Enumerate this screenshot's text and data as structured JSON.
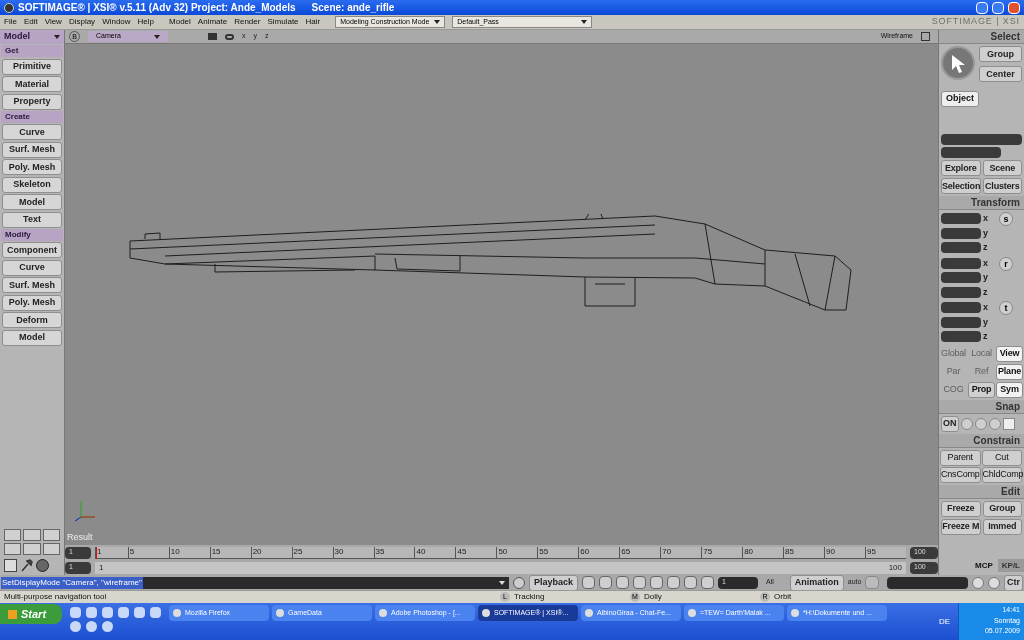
{
  "window": {
    "title": "SOFTIMAGE® | XSI® v.5.11 (Adv 32) Project: Ande_Models",
    "scene": "Scene: ande_rifle"
  },
  "menu": [
    "File",
    "Edit",
    "View",
    "Display",
    "Window",
    "Help",
    "Model",
    "Animate",
    "Render",
    "Simulate",
    "Hair"
  ],
  "mode_dropdown": "Modeling Construction Mode",
  "pass_dropdown": "Default_Pass",
  "brand": "SOFTIMAGE | XSI",
  "module_dropdown": "Model",
  "viewport": {
    "view_button": "B",
    "camera": "Camera",
    "axes": [
      "x",
      "y",
      "z"
    ],
    "display_mode": "Wireframe",
    "result_label": "Result"
  },
  "left_panel": [
    {
      "title": "Get",
      "buttons": [
        "Primitive",
        "Material",
        "Property"
      ]
    },
    {
      "title": "Create",
      "buttons": [
        "Curve",
        "Surf. Mesh",
        "Poly. Mesh",
        "Skeleton",
        "Model",
        "Text"
      ]
    },
    {
      "title": "Modify",
      "buttons": [
        "Component",
        "Curve",
        "Surf. Mesh",
        "Poly. Mesh",
        "Deform",
        "Model"
      ]
    }
  ],
  "right_panel": {
    "select": {
      "title": "Select",
      "buttons": [
        "Group",
        "Center"
      ],
      "object": {
        "label": "Object",
        "selected": true
      },
      "buttons2": [
        "Explore",
        "Scene",
        "Selection",
        "Clusters"
      ]
    },
    "transform": {
      "title": "Transform",
      "groups": [
        {
          "key": "s",
          "axes": [
            "x",
            "y",
            "z"
          ]
        },
        {
          "key": "r",
          "axes": [
            "x",
            "y",
            "z"
          ]
        },
        {
          "key": "t",
          "axes": [
            "x",
            "y",
            "z"
          ]
        }
      ],
      "modes": [
        [
          {
            "label": "Global",
            "disabled": true,
            "selected": false
          },
          {
            "label": "Local",
            "disabled": true,
            "selected": false
          },
          {
            "label": "View",
            "disabled": false,
            "selected": true
          }
        ],
        [
          {
            "label": "Par",
            "disabled": true,
            "selected": false
          },
          {
            "label": "Ref",
            "disabled": true,
            "selected": false
          },
          {
            "label": "Plane",
            "disabled": false,
            "selected": true
          }
        ],
        [
          {
            "label": "COG",
            "disabled": true,
            "selected": false
          },
          {
            "label": "Prop",
            "disabled": false,
            "selected": false
          },
          {
            "label": "Sym",
            "disabled": false,
            "selected": true
          }
        ]
      ]
    },
    "snap": {
      "title": "Snap",
      "on": "ON"
    },
    "constrain": {
      "title": "Constrain",
      "buttons": [
        "Parent",
        "Cut",
        "CnsComp",
        "ChldComp"
      ]
    },
    "edit": {
      "title": "Edit",
      "buttons": [
        "Freeze",
        "Group",
        "Freeze M",
        "Immed"
      ]
    },
    "tabs": [
      {
        "label": "MCP",
        "selected": true
      },
      {
        "label": "KP/L",
        "selected": false
      }
    ]
  },
  "timeline": {
    "ticks": [
      "1",
      "5",
      "10",
      "15",
      "20",
      "25",
      "30",
      "35",
      "40",
      "45",
      "50",
      "55",
      "60",
      "65",
      "70",
      "75",
      "80",
      "85",
      "90",
      "95"
    ],
    "start": "1",
    "end": "100",
    "range_start": "1",
    "range": {
      "marker": "1",
      "end": "100",
      "level": 1
    },
    "range_end": "100"
  },
  "command_line": "SetDisplayMode \"Camera\", \"wireframe\"",
  "playback": {
    "label": "Playback",
    "frame": "1",
    "all": "All",
    "animation": "Animation",
    "auto": "auto",
    "ctr": "Ctr"
  },
  "status": {
    "message": "Multi-purpose navigation tool",
    "mouse": [
      {
        "button": "L",
        "action": "Tracking"
      },
      {
        "button": "M",
        "action": "Dolly"
      },
      {
        "button": "R",
        "action": "Orbit"
      }
    ]
  },
  "taskbar": {
    "start": "Start",
    "tasks": [
      {
        "label": "Mozilla Firefox",
        "selected": false
      },
      {
        "label": "GameData",
        "selected": false
      },
      {
        "label": "Adobe Photoshop - [...",
        "selected": false
      },
      {
        "label": "SOFTIMAGE® | XSI®...",
        "selected": true
      },
      {
        "label": "AlbinoGiraa - Chat-Fe...",
        "selected": false
      },
      {
        "label": "=TEW= Darth'Malak ...",
        "selected": false
      },
      {
        "label": "*H:\\Dokumente und ...",
        "selected": false
      }
    ],
    "language": "DE",
    "time": "14:41",
    "day": "Sonntag",
    "date": "05.07.2009"
  }
}
